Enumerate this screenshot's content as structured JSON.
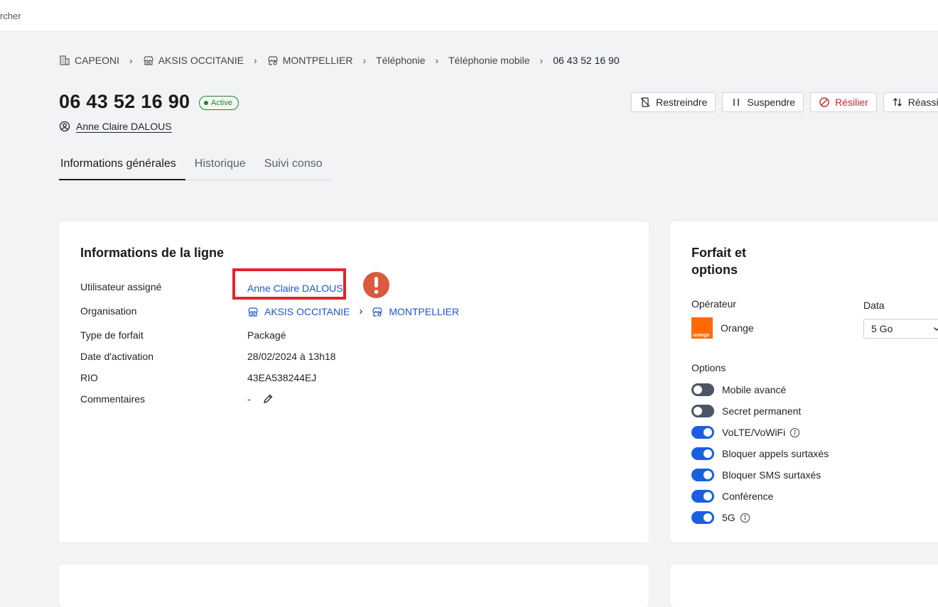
{
  "topbar": {
    "search_fragment": "rcher"
  },
  "breadcrumb": [
    {
      "label": "CAPEONI",
      "icon": "building-icon"
    },
    {
      "label": "AKSIS OCCITANIE",
      "icon": "store-icon"
    },
    {
      "label": "MONTPELLIER",
      "icon": "store-group-icon"
    },
    {
      "label": "Téléphonie"
    },
    {
      "label": "Téléphonie mobile"
    },
    {
      "label": "06 43 52 16 90"
    }
  ],
  "header": {
    "title": "06 43 52 16 90",
    "status": "Active",
    "owner": "Anne Claire DALOUS"
  },
  "actions": {
    "restrict": "Restreindre",
    "suspend": "Suspendre",
    "terminate": "Résilier",
    "reassign": "Réassigner"
  },
  "tabs": [
    "Informations générales",
    "Historique",
    "Suivi conso"
  ],
  "line_info": {
    "title": "Informations de la ligne",
    "labels": {
      "user": "Utilisateur assigné",
      "org": "Organisation",
      "plan_type": "Type de forfait",
      "activation": "Date d'activation",
      "rio": "RIO",
      "comments": "Commentaires"
    },
    "values": {
      "user": "Anne Claire DALOUS",
      "org_parent": "AKSIS OCCITANIE",
      "org_child": "MONTPELLIER",
      "plan_type": "Packagé",
      "activation": "28/02/2024 à 13h18",
      "rio": "43EA538244EJ",
      "comments": "-"
    }
  },
  "plan": {
    "title": "Forfait et options",
    "operator_label": "Opérateur",
    "operator": "Orange",
    "operator_logo_text": "orange",
    "data_label": "Data",
    "data_value": "5 Go",
    "options_label": "Options",
    "options": [
      {
        "label": "Mobile avancé",
        "on": false,
        "info": false
      },
      {
        "label": "Secret permanent",
        "on": false,
        "info": false
      },
      {
        "label": "VoLTE/VoWiFi",
        "on": true,
        "info": true
      },
      {
        "label": "Bloquer appels surtaxés",
        "on": true,
        "info": false
      },
      {
        "label": "Bloquer SMS surtaxés",
        "on": true,
        "info": false
      },
      {
        "label": "Conférence",
        "on": true,
        "info": false
      },
      {
        "label": "5G",
        "on": true,
        "info": true
      }
    ]
  },
  "colors": {
    "accent": "#1a5fe0",
    "link": "#1a56db",
    "danger": "#c62828",
    "highlight": "#e3232f",
    "alert": "#d95a3f",
    "operator_orange": "#ff6a00",
    "status_green": "#2e7d32"
  }
}
